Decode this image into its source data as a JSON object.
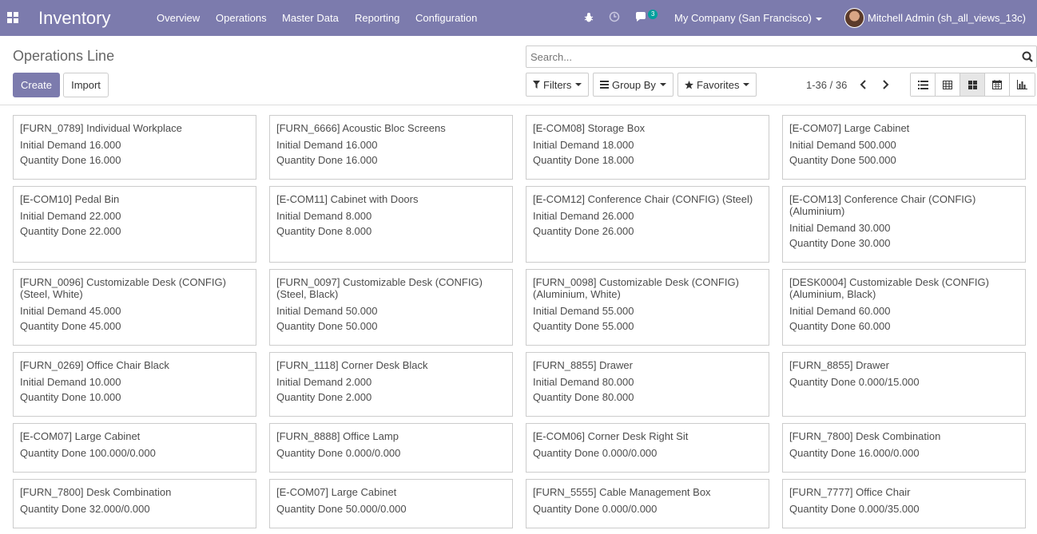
{
  "app": {
    "title": "Inventory"
  },
  "menu": [
    "Overview",
    "Operations",
    "Master Data",
    "Reporting",
    "Configuration"
  ],
  "systray": {
    "messages_count": "3",
    "company": "My Company (San Francisco)",
    "user": "Mitchell Admin (sh_all_views_13c)"
  },
  "control": {
    "breadcrumb": "Operations Line",
    "create_label": "Create",
    "import_label": "Import",
    "search_placeholder": "Search...",
    "filters_label": "Filters",
    "groupby_label": "Group By",
    "favorites_label": "Favorites",
    "pager": "1-36 / 36"
  },
  "colors": {
    "navbar": "#7c7bad",
    "primary": "#7c7bad",
    "badge": "#00a09d"
  },
  "cards": [
    {
      "title": "[FURN_0789] Individual Workplace",
      "lines": [
        "Initial Demand 16.000",
        "Quantity Done 16.000"
      ]
    },
    {
      "title": "[FURN_6666] Acoustic Bloc Screens",
      "lines": [
        "Initial Demand 16.000",
        "Quantity Done 16.000"
      ]
    },
    {
      "title": "[E-COM08] Storage Box",
      "lines": [
        "Initial Demand 18.000",
        "Quantity Done 18.000"
      ]
    },
    {
      "title": "[E-COM07] Large Cabinet",
      "lines": [
        "Initial Demand 500.000",
        "Quantity Done 500.000"
      ]
    },
    {
      "title": "[E-COM10] Pedal Bin",
      "lines": [
        "Initial Demand 22.000",
        "Quantity Done 22.000"
      ]
    },
    {
      "title": "[E-COM11] Cabinet with Doors",
      "lines": [
        "Initial Demand 8.000",
        "Quantity Done 8.000"
      ]
    },
    {
      "title": "[E-COM12] Conference Chair (CONFIG) (Steel)",
      "lines": [
        "Initial Demand 26.000",
        "Quantity Done 26.000"
      ]
    },
    {
      "title": "[E-COM13] Conference Chair (CONFIG) (Aluminium)",
      "lines": [
        "Initial Demand 30.000",
        "Quantity Done 30.000"
      ]
    },
    {
      "title": "[FURN_0096] Customizable Desk (CONFIG) (Steel, White)",
      "lines": [
        "Initial Demand 45.000",
        "Quantity Done 45.000"
      ]
    },
    {
      "title": "[FURN_0097] Customizable Desk (CONFIG) (Steel, Black)",
      "lines": [
        "Initial Demand 50.000",
        "Quantity Done 50.000"
      ]
    },
    {
      "title": "[FURN_0098] Customizable Desk (CONFIG) (Aluminium, White)",
      "lines": [
        "Initial Demand 55.000",
        "Quantity Done 55.000"
      ]
    },
    {
      "title": "[DESK0004] Customizable Desk (CONFIG) (Aluminium, Black)",
      "lines": [
        "Initial Demand 60.000",
        "Quantity Done 60.000"
      ]
    },
    {
      "title": "[FURN_0269] Office Chair Black",
      "lines": [
        "Initial Demand 10.000",
        "Quantity Done 10.000"
      ]
    },
    {
      "title": "[FURN_1118] Corner Desk Black",
      "lines": [
        "Initial Demand 2.000",
        "Quantity Done 2.000"
      ]
    },
    {
      "title": "[FURN_8855] Drawer",
      "lines": [
        "Initial Demand 80.000",
        "Quantity Done 80.000"
      ]
    },
    {
      "title": "[FURN_8855] Drawer",
      "lines": [
        "Quantity Done 0.000/15.000"
      ]
    },
    {
      "title": "[E-COM07] Large Cabinet",
      "lines": [
        "Quantity Done 100.000/0.000"
      ]
    },
    {
      "title": "[FURN_8888] Office Lamp",
      "lines": [
        "Quantity Done 0.000/0.000"
      ]
    },
    {
      "title": "[E-COM06] Corner Desk Right Sit",
      "lines": [
        "Quantity Done 0.000/0.000"
      ]
    },
    {
      "title": "[FURN_7800] Desk Combination",
      "lines": [
        "Quantity Done 16.000/0.000"
      ]
    },
    {
      "title": "[FURN_7800] Desk Combination",
      "lines": [
        "Quantity Done 32.000/0.000"
      ]
    },
    {
      "title": "[E-COM07] Large Cabinet",
      "lines": [
        "Quantity Done 50.000/0.000"
      ]
    },
    {
      "title": "[FURN_5555] Cable Management Box",
      "lines": [
        "Quantity Done 0.000/0.000"
      ]
    },
    {
      "title": "[FURN_7777] Office Chair",
      "lines": [
        "Quantity Done 0.000/35.000"
      ]
    }
  ]
}
